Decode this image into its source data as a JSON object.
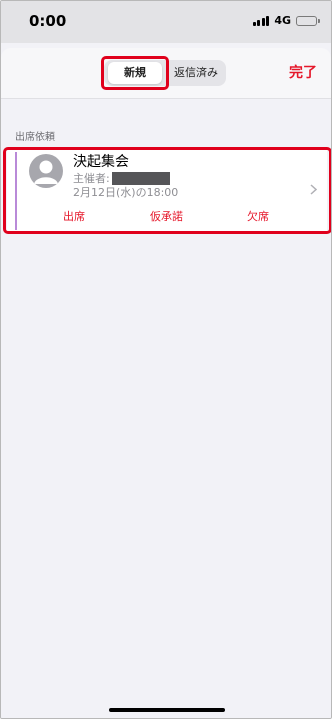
{
  "status_bar": {
    "time": "0:00",
    "network": "4G",
    "battery_level": 1.0
  },
  "header": {
    "tabs": [
      {
        "label": "新規",
        "selected": true
      },
      {
        "label": "返信済み",
        "selected": false
      }
    ],
    "done_label": "完了"
  },
  "section": {
    "label": "出席依頼"
  },
  "invitation": {
    "title": "決起集会",
    "organizer_label": "主催者:",
    "datetime": "2月12日(水)の18:00",
    "actions": {
      "accept": "出席",
      "maybe": "仮承諾",
      "decline": "欠席"
    }
  },
  "colors": {
    "accent": "#e5172a",
    "highlight": "#e0001c",
    "calendar_color": "#b98ad8",
    "background": "#f2f2f7"
  }
}
